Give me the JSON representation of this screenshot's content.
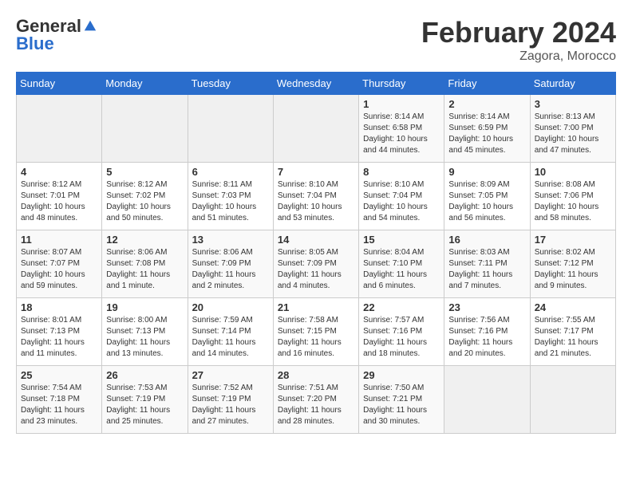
{
  "logo": {
    "general": "General",
    "blue": "Blue"
  },
  "title": "February 2024",
  "subtitle": "Zagora, Morocco",
  "days_header": [
    "Sunday",
    "Monday",
    "Tuesday",
    "Wednesday",
    "Thursday",
    "Friday",
    "Saturday"
  ],
  "weeks": [
    [
      {
        "day": "",
        "info": ""
      },
      {
        "day": "",
        "info": ""
      },
      {
        "day": "",
        "info": ""
      },
      {
        "day": "",
        "info": ""
      },
      {
        "day": "1",
        "info": "Sunrise: 8:14 AM\nSunset: 6:58 PM\nDaylight: 10 hours\nand 44 minutes."
      },
      {
        "day": "2",
        "info": "Sunrise: 8:14 AM\nSunset: 6:59 PM\nDaylight: 10 hours\nand 45 minutes."
      },
      {
        "day": "3",
        "info": "Sunrise: 8:13 AM\nSunset: 7:00 PM\nDaylight: 10 hours\nand 47 minutes."
      }
    ],
    [
      {
        "day": "4",
        "info": "Sunrise: 8:12 AM\nSunset: 7:01 PM\nDaylight: 10 hours\nand 48 minutes."
      },
      {
        "day": "5",
        "info": "Sunrise: 8:12 AM\nSunset: 7:02 PM\nDaylight: 10 hours\nand 50 minutes."
      },
      {
        "day": "6",
        "info": "Sunrise: 8:11 AM\nSunset: 7:03 PM\nDaylight: 10 hours\nand 51 minutes."
      },
      {
        "day": "7",
        "info": "Sunrise: 8:10 AM\nSunset: 7:04 PM\nDaylight: 10 hours\nand 53 minutes."
      },
      {
        "day": "8",
        "info": "Sunrise: 8:10 AM\nSunset: 7:04 PM\nDaylight: 10 hours\nand 54 minutes."
      },
      {
        "day": "9",
        "info": "Sunrise: 8:09 AM\nSunset: 7:05 PM\nDaylight: 10 hours\nand 56 minutes."
      },
      {
        "day": "10",
        "info": "Sunrise: 8:08 AM\nSunset: 7:06 PM\nDaylight: 10 hours\nand 58 minutes."
      }
    ],
    [
      {
        "day": "11",
        "info": "Sunrise: 8:07 AM\nSunset: 7:07 PM\nDaylight: 10 hours\nand 59 minutes."
      },
      {
        "day": "12",
        "info": "Sunrise: 8:06 AM\nSunset: 7:08 PM\nDaylight: 11 hours\nand 1 minute."
      },
      {
        "day": "13",
        "info": "Sunrise: 8:06 AM\nSunset: 7:09 PM\nDaylight: 11 hours\nand 2 minutes."
      },
      {
        "day": "14",
        "info": "Sunrise: 8:05 AM\nSunset: 7:09 PM\nDaylight: 11 hours\nand 4 minutes."
      },
      {
        "day": "15",
        "info": "Sunrise: 8:04 AM\nSunset: 7:10 PM\nDaylight: 11 hours\nand 6 minutes."
      },
      {
        "day": "16",
        "info": "Sunrise: 8:03 AM\nSunset: 7:11 PM\nDaylight: 11 hours\nand 7 minutes."
      },
      {
        "day": "17",
        "info": "Sunrise: 8:02 AM\nSunset: 7:12 PM\nDaylight: 11 hours\nand 9 minutes."
      }
    ],
    [
      {
        "day": "18",
        "info": "Sunrise: 8:01 AM\nSunset: 7:13 PM\nDaylight: 11 hours\nand 11 minutes."
      },
      {
        "day": "19",
        "info": "Sunrise: 8:00 AM\nSunset: 7:13 PM\nDaylight: 11 hours\nand 13 minutes."
      },
      {
        "day": "20",
        "info": "Sunrise: 7:59 AM\nSunset: 7:14 PM\nDaylight: 11 hours\nand 14 minutes."
      },
      {
        "day": "21",
        "info": "Sunrise: 7:58 AM\nSunset: 7:15 PM\nDaylight: 11 hours\nand 16 minutes."
      },
      {
        "day": "22",
        "info": "Sunrise: 7:57 AM\nSunset: 7:16 PM\nDaylight: 11 hours\nand 18 minutes."
      },
      {
        "day": "23",
        "info": "Sunrise: 7:56 AM\nSunset: 7:16 PM\nDaylight: 11 hours\nand 20 minutes."
      },
      {
        "day": "24",
        "info": "Sunrise: 7:55 AM\nSunset: 7:17 PM\nDaylight: 11 hours\nand 21 minutes."
      }
    ],
    [
      {
        "day": "25",
        "info": "Sunrise: 7:54 AM\nSunset: 7:18 PM\nDaylight: 11 hours\nand 23 minutes."
      },
      {
        "day": "26",
        "info": "Sunrise: 7:53 AM\nSunset: 7:19 PM\nDaylight: 11 hours\nand 25 minutes."
      },
      {
        "day": "27",
        "info": "Sunrise: 7:52 AM\nSunset: 7:19 PM\nDaylight: 11 hours\nand 27 minutes."
      },
      {
        "day": "28",
        "info": "Sunrise: 7:51 AM\nSunset: 7:20 PM\nDaylight: 11 hours\nand 28 minutes."
      },
      {
        "day": "29",
        "info": "Sunrise: 7:50 AM\nSunset: 7:21 PM\nDaylight: 11 hours\nand 30 minutes."
      },
      {
        "day": "",
        "info": ""
      },
      {
        "day": "",
        "info": ""
      }
    ]
  ]
}
